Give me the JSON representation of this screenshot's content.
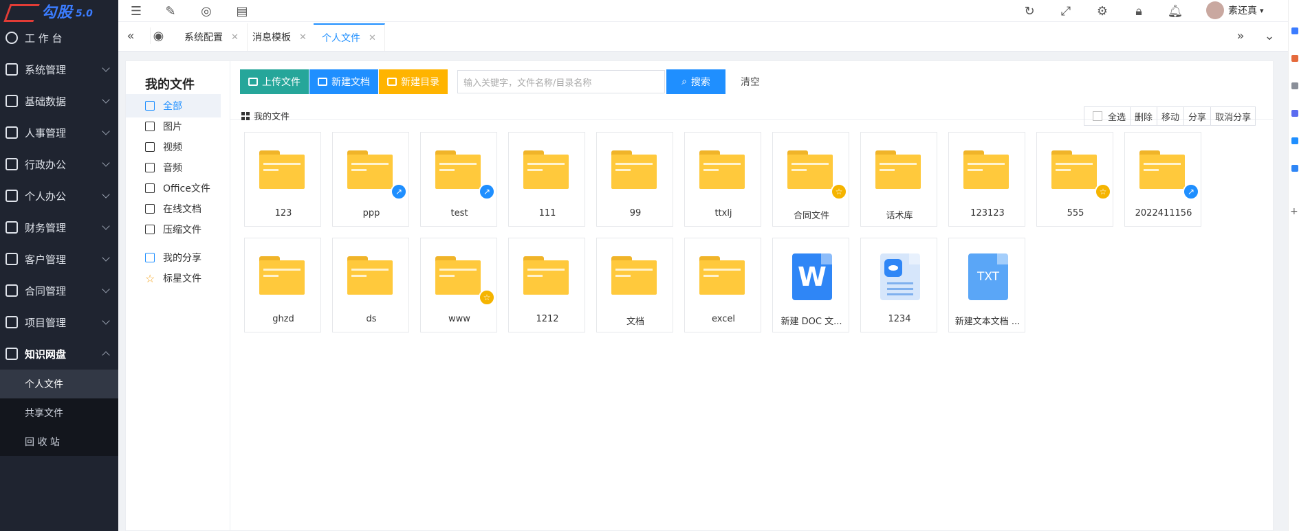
{
  "app": {
    "brand": "勾股",
    "version": "5.0"
  },
  "sidebar": {
    "items": [
      {
        "label": "工 作 台"
      },
      {
        "label": "系统管理"
      },
      {
        "label": "基础数据"
      },
      {
        "label": "人事管理"
      },
      {
        "label": "行政办公"
      },
      {
        "label": "个人办公"
      },
      {
        "label": "财务管理"
      },
      {
        "label": "客户管理"
      },
      {
        "label": "合同管理"
      },
      {
        "label": "项目管理"
      },
      {
        "label": "知识网盘"
      }
    ],
    "sub_items": [
      {
        "label": "个人文件"
      },
      {
        "label": "共享文件"
      },
      {
        "label": "回 收 站"
      }
    ]
  },
  "topbar": {
    "user_name": "素还真"
  },
  "tabs": [
    {
      "label": "系统配置"
    },
    {
      "label": "消息模板"
    },
    {
      "label": "个人文件"
    }
  ],
  "left_panel": {
    "title": "我的文件",
    "items": [
      {
        "label": "全部"
      },
      {
        "label": "图片"
      },
      {
        "label": "视频"
      },
      {
        "label": "音频"
      },
      {
        "label": "Office文件"
      },
      {
        "label": "在线文档"
      },
      {
        "label": "压缩文件"
      },
      {
        "label": "我的分享"
      },
      {
        "label": "标星文件"
      }
    ]
  },
  "toolbar": {
    "upload_label": "上传文件",
    "new_doc_label": "新建文档",
    "new_dir_label": "新建目录",
    "search_placeholder": "输入关键字，文件名称/目录名称",
    "search_label": "搜索",
    "clear_label": "清空"
  },
  "breadcrumb": {
    "label": "我的文件"
  },
  "actions": {
    "select_all": "全选",
    "delete": "删除",
    "move": "移动",
    "share": "分享",
    "cancel_share": "取消分享"
  },
  "files": [
    {
      "name": "123",
      "type": "folder",
      "badge": ""
    },
    {
      "name": "ppp",
      "type": "folder",
      "badge": "share"
    },
    {
      "name": "test",
      "type": "folder",
      "badge": "share"
    },
    {
      "name": "111",
      "type": "folder",
      "badge": ""
    },
    {
      "name": "99",
      "type": "folder",
      "badge": ""
    },
    {
      "name": "ttxlj",
      "type": "folder",
      "badge": ""
    },
    {
      "name": "合同文件",
      "type": "folder",
      "badge": "star"
    },
    {
      "name": "话术库",
      "type": "folder",
      "badge": ""
    },
    {
      "name": "123123",
      "type": "folder",
      "badge": ""
    },
    {
      "name": "555",
      "type": "folder",
      "badge": "star"
    },
    {
      "name": "2022411156",
      "type": "folder",
      "badge": "share"
    },
    {
      "name": "ghzd",
      "type": "folder",
      "badge": ""
    },
    {
      "name": "ds",
      "type": "folder",
      "badge": ""
    },
    {
      "name": "www",
      "type": "folder",
      "badge": "star"
    },
    {
      "name": "1212",
      "type": "folder",
      "badge": ""
    },
    {
      "name": "文档",
      "type": "folder",
      "badge": ""
    },
    {
      "name": "excel",
      "type": "folder",
      "badge": ""
    },
    {
      "name": "新建 DOC 文...",
      "type": "word",
      "badge": "",
      "glyph": "W"
    },
    {
      "name": "1234",
      "type": "view",
      "badge": ""
    },
    {
      "name": "新建文本文档 ...",
      "type": "txt",
      "badge": "",
      "glyph": "TXT"
    }
  ],
  "colors": {
    "sidebar_bg": "#1f2430",
    "accent": "#1f8fff",
    "upload_btn": "#26a69a",
    "new_doc_btn": "#1f8fff",
    "new_dir_btn": "#ffb400",
    "folder": "#ffc93c"
  }
}
